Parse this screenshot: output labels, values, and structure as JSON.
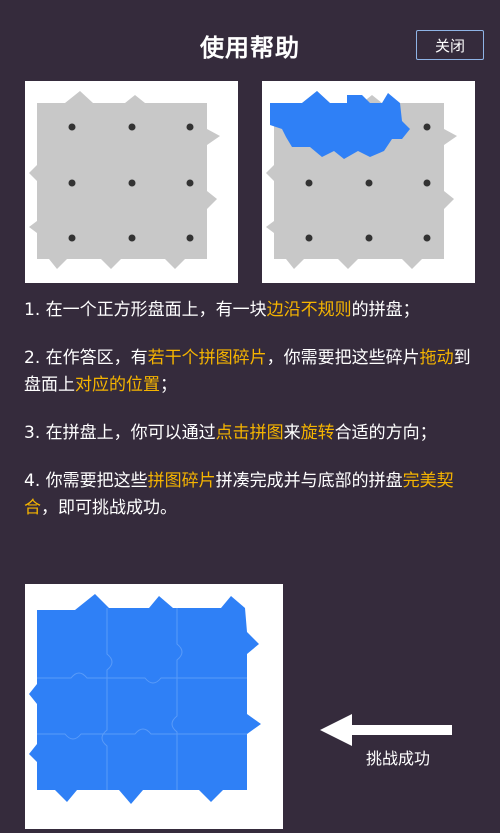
{
  "header": {
    "title": "使用帮助",
    "close_label": "关闭"
  },
  "colors": {
    "background": "#352b3c",
    "highlight": "#f5b400",
    "piece_blue": "#2f80f6",
    "board_gray": "#c8c8c8",
    "button_border": "#8fb4e6"
  },
  "steps": [
    {
      "parts": [
        "1. 在一个正方形盘面上，有一块",
        "边沿不规则",
        "的拼盘；"
      ]
    },
    {
      "parts": [
        "2. 在作答区，有",
        "若干个拼图碎片",
        "，你需要把这些碎片",
        "拖动",
        "到盘面上",
        "对应的位置",
        "；"
      ]
    },
    {
      "parts": [
        "3. 在拼盘上，你可以通过",
        "点击拼图",
        "来",
        "旋转",
        "合适的方向；"
      ]
    },
    {
      "parts": [
        "4. 你需要把这些",
        "拼图碎片",
        "拼凑完成并与底部的拼盘",
        "完美契合",
        "，即可挑战成功。"
      ]
    }
  ],
  "success_label": "挑战成功",
  "icons": {
    "arrow": "arrow-left-icon"
  }
}
